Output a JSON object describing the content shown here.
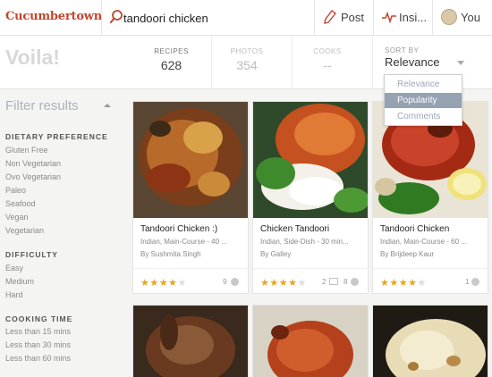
{
  "app": {
    "logo": "Cucumbertown"
  },
  "search": {
    "value": "tandoori chicken"
  },
  "nav": {
    "post": "Post",
    "insights": "Insi...",
    "you": "You"
  },
  "header": {
    "heading": "Voila!"
  },
  "stats": {
    "recipes": {
      "label": "RECIPES",
      "value": "628"
    },
    "photos": {
      "label": "PHOTOS",
      "value": "354"
    },
    "cooks": {
      "label": "COOKS",
      "value": "--"
    }
  },
  "sort": {
    "label": "SORT BY",
    "value": "Relevance",
    "options": [
      "Relevance",
      "Popularity",
      "Comments"
    ],
    "highlighted": "Popularity"
  },
  "filters": {
    "title": "Filter results",
    "groups": [
      {
        "heading": "DIETARY PREFERENCE",
        "options": [
          "Gluten Free",
          "Non Vegetarian",
          "Ovo Vegetarian",
          "Paleo",
          "Seafood",
          "Vegan",
          "Vegetarian"
        ]
      },
      {
        "heading": "DIFFICULTY",
        "options": [
          "Easy",
          "Medium",
          "Hard"
        ]
      },
      {
        "heading": "COOKING TIME",
        "options": [
          "Less than 15 mins",
          "Less than 30 mins",
          "Less than 60 mins"
        ]
      }
    ]
  },
  "cards": [
    {
      "title": "Tandoori Chicken :)",
      "meta": "Indian, Main-Course - 40 ...",
      "author": "By Sushmita Singh",
      "rating": 4,
      "comments": "",
      "count": "9"
    },
    {
      "title": "Chicken Tandoori",
      "meta": "Indian, Side-Dish - 30 min...",
      "author": "By Galley",
      "rating": 4,
      "comments": "2",
      "count": "8"
    },
    {
      "title": "Tandoori Chicken",
      "meta": "Indian, Main-Course - 60 ...",
      "author": "By Brijdeep Kaur",
      "rating": 4,
      "comments": "",
      "count": "1"
    }
  ],
  "colors": {
    "brand": "#c2452d",
    "star": "#e8a320",
    "dropdown_highlight": "#94a2b2"
  }
}
